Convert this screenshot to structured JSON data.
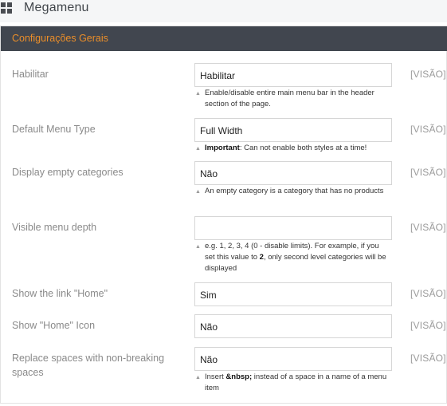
{
  "page": {
    "title": "Megamenu"
  },
  "panel": {
    "title": "Configurações Gerais"
  },
  "scope_label": "[VISÃO]",
  "rows": [
    {
      "label": "Habilitar",
      "value": "Habilitar",
      "note": {
        "text": "Enable/disable entire main menu bar in the header section of the page."
      }
    },
    {
      "label": "Default Menu Type",
      "value": "Full Width",
      "note": {
        "bold": "Important",
        "text": ": Can not enable both styles at a time!"
      }
    },
    {
      "label": "Display empty categories",
      "value": "Não",
      "note": {
        "text": "An empty category is a category that has no products"
      }
    },
    {
      "label": "Visible menu depth",
      "value": "",
      "note": {
        "text_before": "e.g. 1, 2, 3, 4 (0 - disable limits). For example, if you set this value to ",
        "bold": "2",
        "text_after": ", only second level categories will be displayed"
      }
    },
    {
      "label": "Show the link \"Home\"",
      "value": "Sim"
    },
    {
      "label": "Show \"Home\" Icon",
      "value": "Não"
    },
    {
      "label": "Replace spaces with non-breaking spaces",
      "value": "Não",
      "note": {
        "text_before": "Insert ",
        "bold": "&nbsp;",
        "text_after": " instead of a space in a name of a menu item"
      }
    }
  ],
  "icons": {
    "page": "grid-icon",
    "note": "triangle-up-icon"
  }
}
